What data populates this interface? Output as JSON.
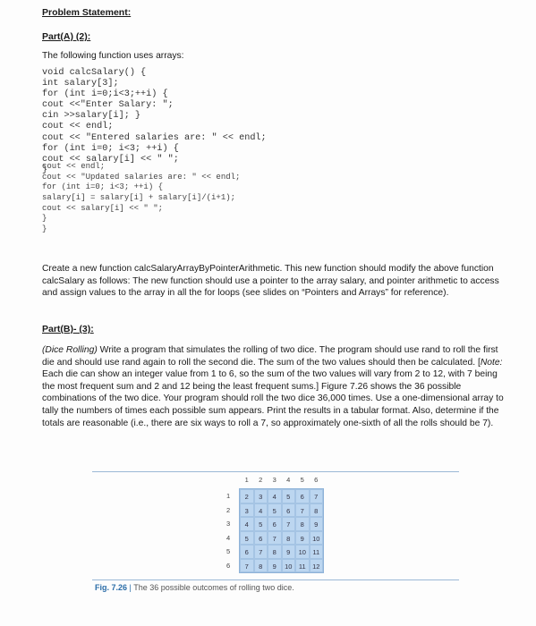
{
  "heading": "Problem Statement:",
  "partA": {
    "title": "Part(A) (2):",
    "intro": "The following function uses arrays:",
    "code": [
      "void calcSalary() {",
      "int salary[3];",
      "for (int i=0;i<3;++i) {",
      "cout <<\"Enter Salary: \";",
      "cin >>salary[i]; }",
      "cout << endl;",
      "cout << \"Entered salaries are: \" << endl;",
      "for (int i=0; i<3; ++i) {",
      "cout << salary[i] << \" \";",
      "}"
    ],
    "code_small": [
      "cout << endl;",
      "cout << \"Updated salaries are: \" << endl;",
      "for (int i=0; i<3; ++i) {",
      "salary[i] = salary[i] + salary[i]/(i+1);",
      "cout << salary[i] << \" \";",
      "}",
      "}"
    ],
    "task": "Create a new function calcSalaryArrayByPointerArithmetic. This new function should modify the above function calcSalary as follows: The new function should use a pointer to the array salary, and pointer arithmetic to access and assign values to the array in all the for loops (see slides on “Pointers and Arrays” for reference)."
  },
  "partB": {
    "title": "Part(B)- (3):",
    "lead": "(Dice Rolling)",
    "text1": " Write a program that simulates the rolling of two dice. The program should use rand to roll the first die and should use rand again to roll the second die. The sum of the two values should then be calculated. [",
    "note": "Note:",
    "text2": " Each die can show an integer value from 1 to 6, so the sum of the two values will vary from 2 to 12, with 7 being the most frequent sum and 2 and 12 being the least frequent sums.] Figure 7.26 shows the 36 possible combinations of the two dice. Your program should roll the two dice 36,000 times. Use a one-dimensional array to tally the numbers of times each possible sum appears. Print the results in a tabular format. Also, determine if the totals are reasonable (i.e., there are six ways to roll a 7, so approximately one-sixth of all the rolls should be 7)."
  },
  "figure": {
    "col_headers": [
      "1",
      "2",
      "3",
      "4",
      "5",
      "6"
    ],
    "row_headers": [
      "1",
      "2",
      "3",
      "4",
      "5",
      "6"
    ],
    "cells": [
      [
        "2",
        "3",
        "4",
        "5",
        "6",
        "7"
      ],
      [
        "3",
        "4",
        "5",
        "6",
        "7",
        "8"
      ],
      [
        "4",
        "5",
        "6",
        "7",
        "8",
        "9"
      ],
      [
        "5",
        "6",
        "7",
        "8",
        "9",
        "10"
      ],
      [
        "6",
        "7",
        "8",
        "9",
        "10",
        "11"
      ],
      [
        "7",
        "8",
        "9",
        "10",
        "11",
        "12"
      ]
    ],
    "caption_label": "Fig. 7.26",
    "caption_sep": "|",
    "caption_text": "The 36 possible outcomes of rolling two dice."
  }
}
